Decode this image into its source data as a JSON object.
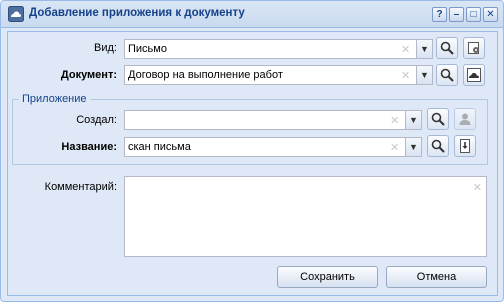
{
  "window": {
    "title": "Добавление приложения к документу",
    "controls": {
      "help": "?",
      "minimize": "–",
      "maximize": "□",
      "close": "✕"
    }
  },
  "form": {
    "vid": {
      "label": "Вид:",
      "value": "Письмо"
    },
    "document": {
      "label": "Документ:",
      "value": "Договор на выполнение работ"
    },
    "attachment_group": {
      "legend": "Приложение",
      "created_by": {
        "label": "Создал:",
        "value": ""
      },
      "name": {
        "label": "Название:",
        "value": "скан письма"
      }
    },
    "comment": {
      "label": "Комментарий:",
      "value": ""
    }
  },
  "buttons": {
    "save": "Сохранить",
    "cancel": "Отмена"
  },
  "icons": {
    "clear": "✕",
    "dropdown": "▼",
    "window_icon": "cloud-icon",
    "search": "search-icon",
    "settings": "settings-icon",
    "user": "user-icon",
    "upload": "upload-icon"
  },
  "colors": {
    "title_text": "#15428b",
    "panel_bg": "#dfe8f6",
    "border": "#99bbe8"
  }
}
